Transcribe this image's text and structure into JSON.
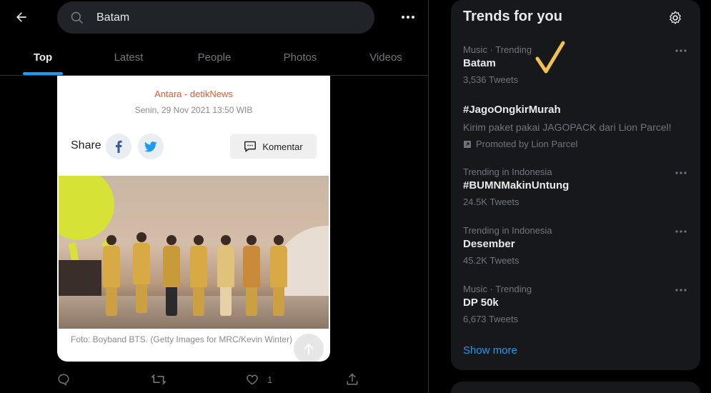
{
  "search": {
    "query": "Batam"
  },
  "tabs": [
    {
      "label": "Top",
      "active": true
    },
    {
      "label": "Latest",
      "active": false
    },
    {
      "label": "People",
      "active": false
    },
    {
      "label": "Photos",
      "active": false
    },
    {
      "label": "Videos",
      "active": false
    }
  ],
  "article": {
    "source": "Antara - detikNews",
    "date": "Senin, 29 Nov 2021 13:50 WIB",
    "share_label": "Share",
    "komentar_label": "Komentar",
    "caption": "Foto: Boyband BTS. (Getty Images for MRC/Kevin Winter)"
  },
  "tweet_actions": {
    "reply_count": "",
    "retweet_count": "",
    "like_count": "1"
  },
  "trends": {
    "title": "Trends for you",
    "items": [
      {
        "meta": "Music · Trending",
        "name": "Batam",
        "count": "3,536 Tweets"
      },
      {
        "meta": "",
        "name": "#JagoOngkirMurah",
        "desc": "Kirim paket pakai JAGOPACK dari Lion Parcel!",
        "promoted": "Promoted by Lion Parcel"
      },
      {
        "meta": "Trending in Indonesia",
        "name": "#BUMNMakinUntung",
        "count": "24.5K Tweets"
      },
      {
        "meta": "Trending in Indonesia",
        "name": "Desember",
        "count": "45.2K Tweets"
      },
      {
        "meta": "Music · Trending",
        "name": "DP 50k",
        "count": "6,673 Tweets"
      }
    ],
    "show_more": "Show more"
  },
  "colors": {
    "accent": "#1d9bf0",
    "background": "#000000",
    "panel": "#16181c",
    "source_orange": "#e45a2b",
    "checkmark": "#f2c14e"
  }
}
